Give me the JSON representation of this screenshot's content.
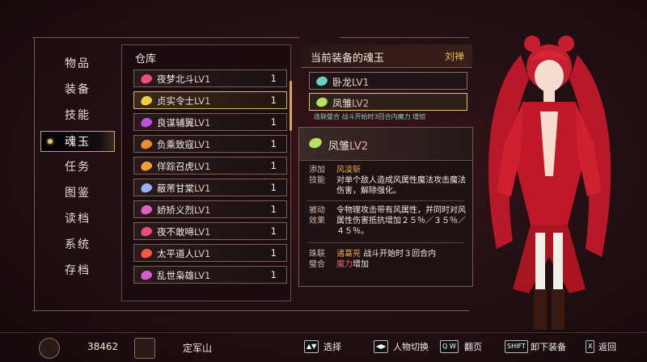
{
  "menu": {
    "items": [
      "物品",
      "装备",
      "技能",
      "魂玉",
      "任务",
      "图鉴",
      "读档",
      "系统",
      "存档"
    ],
    "active_index": 3
  },
  "warehouse": {
    "title": "仓库",
    "items": [
      {
        "name": "夜梦北斗",
        "lv": "LV1",
        "count": "1",
        "gem_color": "#e8507a"
      },
      {
        "name": "贞实令士",
        "lv": "LV1",
        "count": "1",
        "gem_color": "#f0d040"
      },
      {
        "name": "良谋辅翼",
        "lv": "LV1",
        "count": "1",
        "gem_color": "#c050e0"
      },
      {
        "name": "负乘致寇",
        "lv": "LV1",
        "count": "1",
        "gem_color": "#f08c30"
      },
      {
        "name": "佯踪召虎",
        "lv": "LV1",
        "count": "1",
        "gem_color": "#f0a030"
      },
      {
        "name": "蔽芾甘棠",
        "lv": "LV1",
        "count": "1",
        "gem_color": "#9ab0f0"
      },
      {
        "name": "娇矫义烈",
        "lv": "LV1",
        "count": "1",
        "gem_color": "#e060c0"
      },
      {
        "name": "夜不敢啼",
        "lv": "LV1",
        "count": "1",
        "gem_color": "#e8507a"
      },
      {
        "name": "太平道人",
        "lv": "LV1",
        "count": "1",
        "gem_color": "#f05a40"
      },
      {
        "name": "乱世枭雄",
        "lv": "LV1",
        "count": "1",
        "gem_color": "#d060d0"
      }
    ],
    "selected_index": 1
  },
  "equipped": {
    "title": "当前装备的魂玉",
    "character": "刘禅",
    "items": [
      {
        "name": "卧龙",
        "lv": "LV1",
        "gem_color": "#6ad0c8"
      },
      {
        "name": "凤雏",
        "lv": "LV2",
        "gem_color": "#b8e060"
      }
    ],
    "selected_index": 1,
    "combo_hint": "连联璧合 战斗开始时3回合内魔力 增加"
  },
  "detail": {
    "name": "凤雏",
    "lv": "LV2",
    "sections": {
      "skill_label": "添加技能",
      "skill_name": "风凌斩",
      "skill_desc": "对单个敌人造成风属性魔法攻击魔法伤害，解除强化。",
      "passive_label": "被动效果",
      "passive_desc": "令物理攻击带有风属性，并同时对风属性伤害抵抗增加２５％／３５％／４５％。",
      "combo_label": "珠联璧合",
      "combo_partner": "诸葛亮",
      "combo_desc1": "战斗开始时３回合内",
      "combo_stat": "魔力",
      "combo_desc2": "增加"
    }
  },
  "footer": {
    "money": "38462",
    "location": "定军山",
    "controls": [
      {
        "key": "▲▼",
        "label": "选择"
      },
      {
        "key": "◀▶",
        "label": "人物切换"
      },
      {
        "key": "Q W",
        "label": "翻页"
      },
      {
        "key": "SHIFT",
        "label": "卸下装备"
      },
      {
        "key": "X",
        "label": "返回"
      }
    ]
  }
}
